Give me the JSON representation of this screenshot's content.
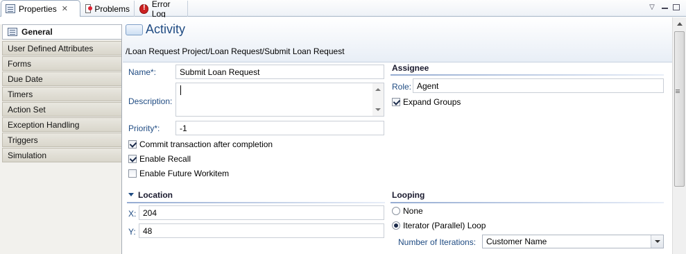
{
  "tabs": [
    {
      "label": "Properties",
      "icon": "properties-icon",
      "active": true,
      "closable": true
    },
    {
      "label": "Problems",
      "icon": "problems-icon",
      "active": false
    },
    {
      "label": "Error Log",
      "icon": "error-log-icon",
      "active": false
    }
  ],
  "sidebar": {
    "items": [
      {
        "label": "General",
        "selected": true
      },
      {
        "label": "User Defined Attributes"
      },
      {
        "label": "Forms"
      },
      {
        "label": "Due Date"
      },
      {
        "label": "Timers"
      },
      {
        "label": "Action Set"
      },
      {
        "label": "Exception Handling"
      },
      {
        "label": "Triggers"
      },
      {
        "label": "Simulation"
      }
    ]
  },
  "header": {
    "title": "Activity",
    "breadcrumb": "/Loan Request Project/Loan Request/Submit Loan Request"
  },
  "general": {
    "name_label": "Name*:",
    "name_value": "Submit Loan Request",
    "description_label": "Description:",
    "description_value": "",
    "priority_label": "Priority*:",
    "priority_value": "-1",
    "commit_label": "Commit transaction after completion",
    "commit_checked": true,
    "recall_label": "Enable Recall",
    "recall_checked": true,
    "future_label": "Enable Future Workitem",
    "future_checked": false
  },
  "assignee": {
    "title": "Assignee",
    "role_label": "Role:",
    "role_value": "Agent",
    "expand_label": "Expand Groups",
    "expand_checked": true
  },
  "location": {
    "title": "Location",
    "x_label": "X:",
    "x_value": "204",
    "y_label": "Y:",
    "y_value": "48"
  },
  "looping": {
    "title": "Looping",
    "none_label": "None",
    "iterator_label": "Iterator (Parallel) Loop",
    "selected": "Iterator (Parallel) Loop",
    "iterations_label": "Number of Iterations:",
    "iterations_value": "Customer Name"
  },
  "colors": {
    "label_blue": "#1f4b82",
    "header_title": "#1f4b82"
  }
}
